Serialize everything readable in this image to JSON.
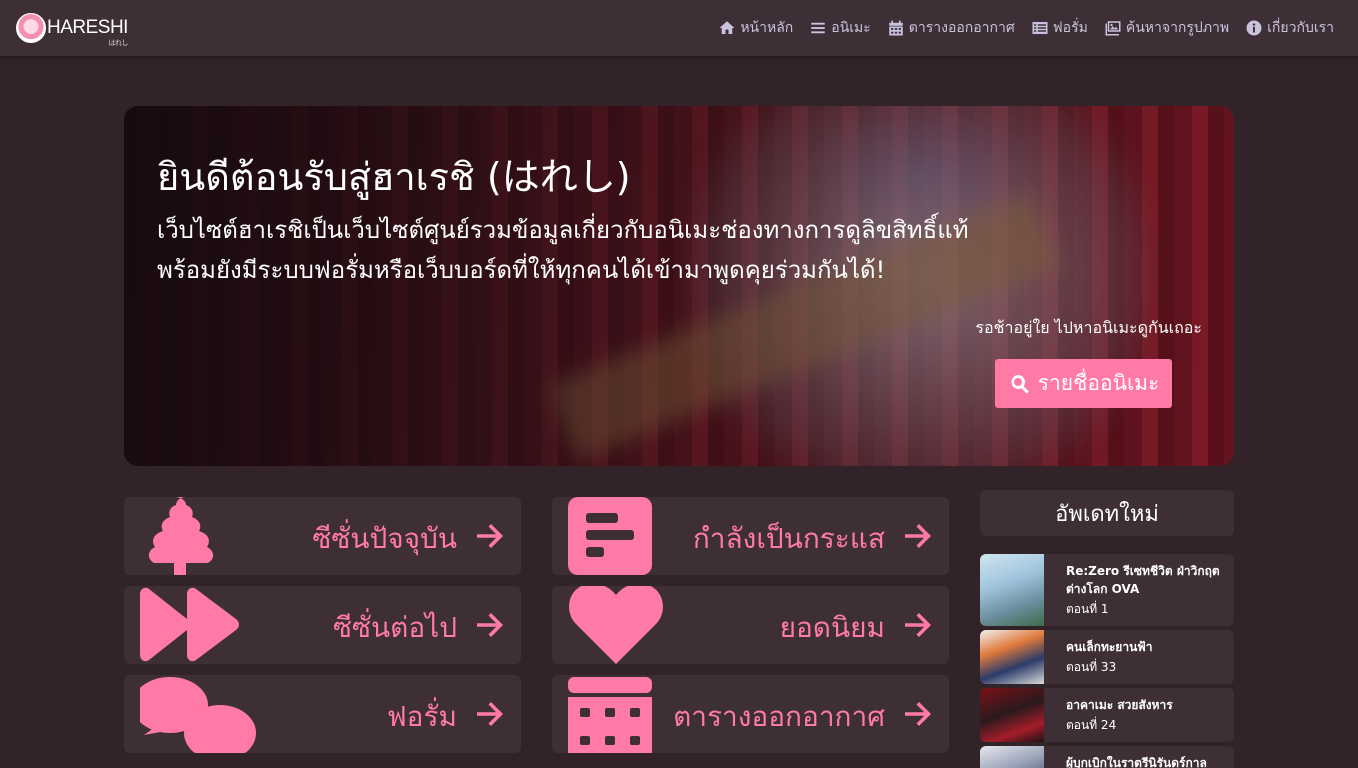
{
  "navbar": {
    "logo_text": "HARESHI",
    "logo_sub": "はれし",
    "items": [
      {
        "label": "หน้าหลัก",
        "icon": "home-icon"
      },
      {
        "label": "อนิเมะ",
        "icon": "list-icon"
      },
      {
        "label": "ตารางออกอากาศ",
        "icon": "calendar-icon"
      },
      {
        "label": "ฟอรั่ม",
        "icon": "forum-list-icon"
      },
      {
        "label": "ค้นหาจากรูปภาพ",
        "icon": "image-search-icon"
      },
      {
        "label": "เกี่ยวกับเรา",
        "icon": "info-icon"
      }
    ]
  },
  "hero": {
    "title": "ยินดีต้อนรับสู่ฮาเรชิ (はれし)",
    "desc_line1": "เว็บไซต์ฮาเรชิเป็นเว็บไซต์ศูนย์รวมข้อมูลเกี่ยวกับอนิเมะช่องทางการดูลิขสิทธิ์แท้",
    "desc_line2": "พร้อมยังมีระบบฟอรั่มหรือเว็บบอร์ดที่ให้ทุกคนได้เข้ามาพูดคุยร่วมกันได้!",
    "wait_text": "รอช้าอยู่ใย ไปหาอนิเมะดูกันเถอะ",
    "button_label": "รายชื่ออนิเมะ"
  },
  "cards": [
    {
      "label": "ซีซั่นปัจจุบัน",
      "icon": "tree-icon"
    },
    {
      "label": "กำลังเป็นกระแส",
      "icon": "trending-chart-icon"
    },
    {
      "label": "ซีซั่นต่อไป",
      "icon": "fast-forward-icon"
    },
    {
      "label": "ยอดนิยม",
      "icon": "heart-icon"
    },
    {
      "label": "ฟอรั่ม",
      "icon": "comments-icon"
    },
    {
      "label": "ตารางออกอากาศ",
      "icon": "calendar-icon"
    }
  ],
  "updates": {
    "heading": "อัพเดทใหม่",
    "items": [
      {
        "title": "Re:Zero รีเซทชีวิต ฝ่าวิกฤตต่างโลก OVA",
        "episode": "ตอนที่ 1"
      },
      {
        "title": "คนเล็กทะยานฟ้า",
        "episode": "ตอนที่ 33"
      },
      {
        "title": "อาคาเมะ สวยสังหาร",
        "episode": "ตอนที่ 24"
      },
      {
        "title": "ผู้บุกเบิกในราตรีนิรันดร์กาล",
        "episode": ""
      }
    ]
  },
  "colors": {
    "accent": "#ff7aa5",
    "background": "#322329",
    "panel": "#3e2f37",
    "nav_text": "#c9c3dd"
  }
}
